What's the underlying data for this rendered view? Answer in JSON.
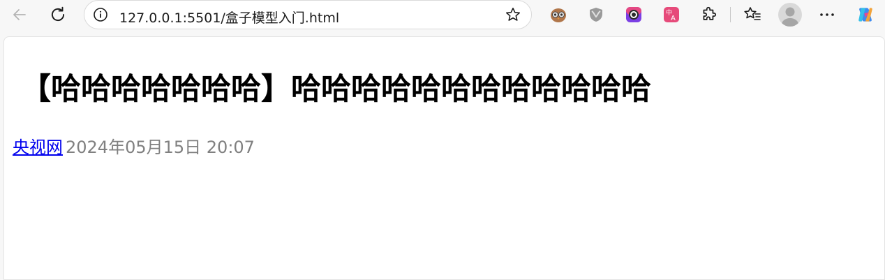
{
  "browser": {
    "url": "127.0.0.1:5501/盒子模型入门.html",
    "icons": {
      "back": "back-arrow-icon",
      "reload": "reload-icon",
      "info": "site-info-icon",
      "favorite": "star-icon",
      "extension1": "owl-extension-icon",
      "extension2": "shield-extension-icon",
      "extension3": "camera-extension-icon",
      "extension4": "translate-extension-icon",
      "extensions": "puzzle-icon",
      "favorites": "favorites-list-icon",
      "profile": "profile-avatar-icon",
      "menu": "more-dots-icon",
      "copilot": "copilot-icon"
    }
  },
  "article": {
    "title": "【哈哈哈哈哈哈哈】哈哈哈哈哈哈哈哈哈哈哈哈",
    "source": "央视网",
    "time": "2024年05月15日 20:07"
  },
  "colors": {
    "link": "#0000ee",
    "meta_text": "#808080",
    "toolbar_bg": "#f7f7f7"
  }
}
